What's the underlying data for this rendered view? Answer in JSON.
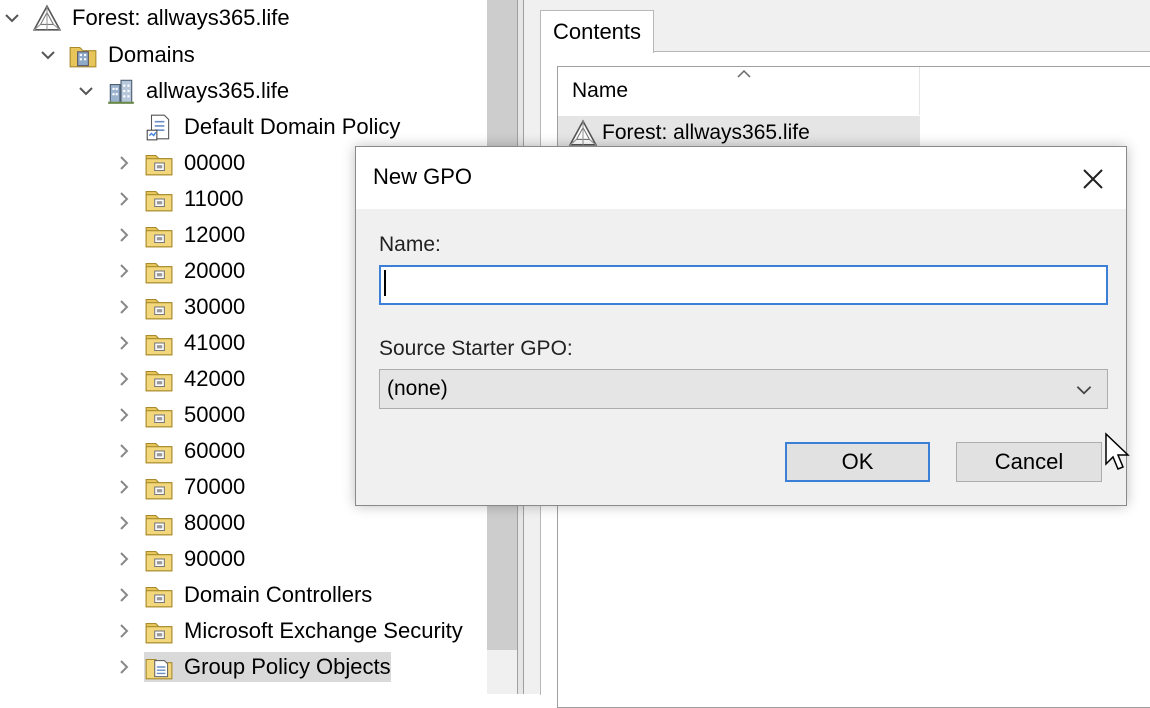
{
  "tree": {
    "forest": "Forest: allways365.life",
    "domains": "Domains",
    "domain": "allways365.life",
    "default_policy": "Default Domain Policy",
    "ous": [
      "00000",
      "11000",
      "12000",
      "20000",
      "30000",
      "41000",
      "42000",
      "50000",
      "60000",
      "70000",
      "80000",
      "90000",
      "Domain Controllers",
      "Microsoft Exchange Security"
    ],
    "gpo_container": "Group Policy Objects"
  },
  "right_pane": {
    "tab_contents": "Contents",
    "column_name": "Name",
    "row_forest": "Forest: allways365.life"
  },
  "dialog": {
    "title": "New GPO",
    "name_label": "Name:",
    "name_value": "",
    "source_label": "Source Starter GPO:",
    "source_value": "(none)",
    "ok_label": "OK",
    "cancel_label": "Cancel"
  },
  "colors": {
    "accent_border": "#3c7fd6",
    "folder_yellow": "#e8c55a",
    "selection_gray": "#d9d9d9"
  },
  "icons": {
    "forest": "forest-triangle-icon",
    "domains": "domains-folder-icon",
    "domain": "domain-building-icon",
    "policy": "policy-document-icon",
    "ou": "ou-folder-icon",
    "gpo_folder": "gpo-folder-icon",
    "close": "close-icon",
    "dropdown": "chevron-down-icon"
  }
}
